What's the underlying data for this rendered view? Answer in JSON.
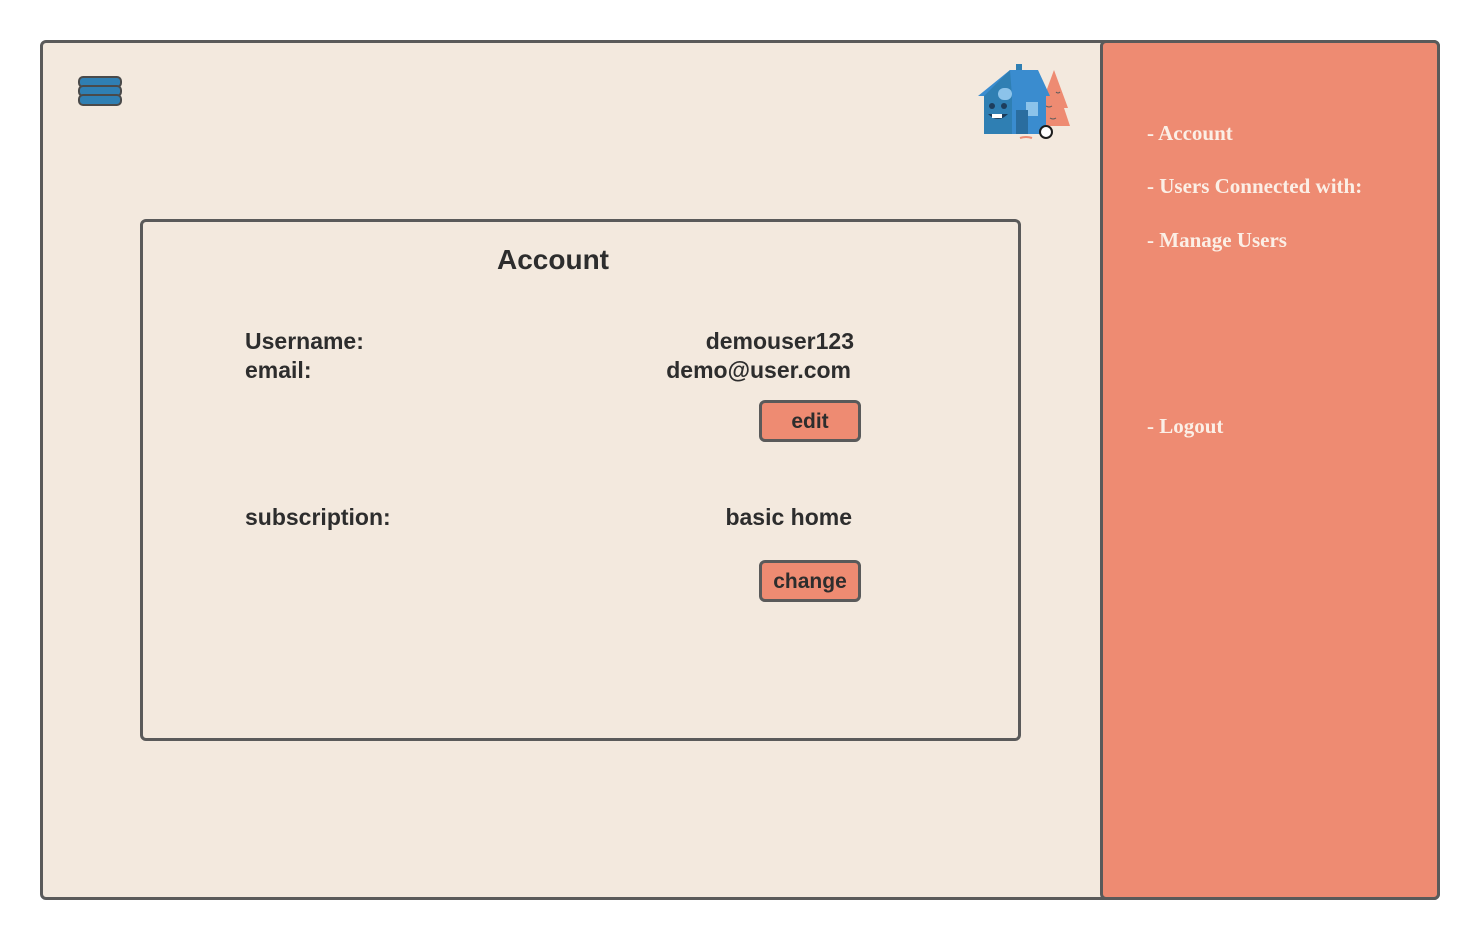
{
  "colors": {
    "background": "#f3e9de",
    "sidebar": "#ee8b72",
    "button": "#ee8b72",
    "border": "#5a5a5a",
    "menu_icon": "#2f7fb3",
    "text": "#2d2d2d",
    "sidebar_text": "#fbefe6"
  },
  "icons": {
    "menu": "hamburger-menu-icon",
    "logo": "house-logo-icon"
  },
  "sidebar": {
    "items": [
      {
        "label": "- Account"
      },
      {
        "label": "- Users Connected with:"
      },
      {
        "label": "- Manage Users"
      },
      {
        "label": "- Logout"
      }
    ]
  },
  "account": {
    "title": "Account",
    "username_label": "Username:",
    "username_value": "demouser123",
    "email_label": "email:",
    "email_value": "demo@user.com",
    "edit_label": "edit",
    "subscription_label": "subscription:",
    "subscription_value": "basic home",
    "change_label": "change"
  }
}
